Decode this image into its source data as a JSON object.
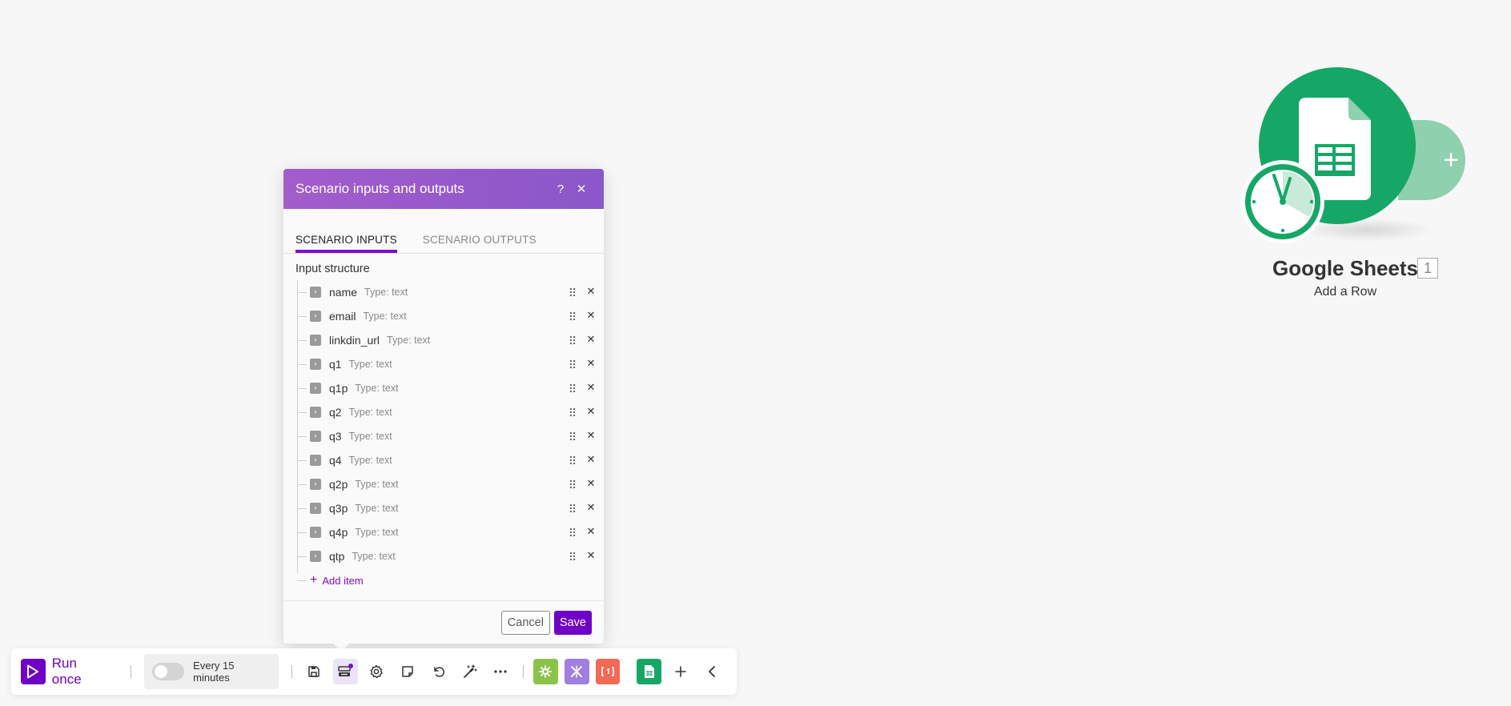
{
  "dialog": {
    "title": "Scenario inputs and outputs",
    "help_label": "?",
    "close_label": "✕",
    "tabs": [
      {
        "label": "SCENARIO INPUTS",
        "active": true
      },
      {
        "label": "SCENARIO OUTPUTS",
        "active": false
      }
    ],
    "section_label": "Input structure",
    "items": [
      {
        "name": "name",
        "type": "Type: text"
      },
      {
        "name": "email",
        "type": "Type: text"
      },
      {
        "name": "linkdin_url",
        "type": "Type: text"
      },
      {
        "name": "q1",
        "type": "Type: text"
      },
      {
        "name": "q1p",
        "type": "Type: text"
      },
      {
        "name": "q2",
        "type": "Type: text"
      },
      {
        "name": "q3",
        "type": "Type: text"
      },
      {
        "name": "q4",
        "type": "Type: text"
      },
      {
        "name": "q2p",
        "type": "Type: text"
      },
      {
        "name": "q3p",
        "type": "Type: text"
      },
      {
        "name": "q4p",
        "type": "Type: text"
      },
      {
        "name": "qtp",
        "type": "Type: text"
      }
    ],
    "add_item_label": "Add item",
    "cancel_label": "Cancel",
    "save_label": "Save"
  },
  "node": {
    "title": "Google Sheets",
    "badge": "1",
    "subtitle": "Add a Row",
    "brand_color": "#16a766"
  },
  "toolbar": {
    "run_label": "Run once",
    "schedule_label": "Every 15 minutes",
    "schedule_enabled": false,
    "icons": [
      "save-icon",
      "io-icon",
      "gear-icon",
      "note-icon",
      "undo-icon",
      "magic-wand-icon",
      "more-icon"
    ],
    "apps": [
      {
        "name": "tools-app",
        "color": "#8bc34a"
      },
      {
        "name": "flow-control-app",
        "color": "#a07fe0"
      },
      {
        "name": "text-parser-app",
        "color": "#f06a55"
      },
      {
        "name": "google-sheets-app",
        "color": "#16a766"
      }
    ],
    "accent": "#6f00c7"
  }
}
